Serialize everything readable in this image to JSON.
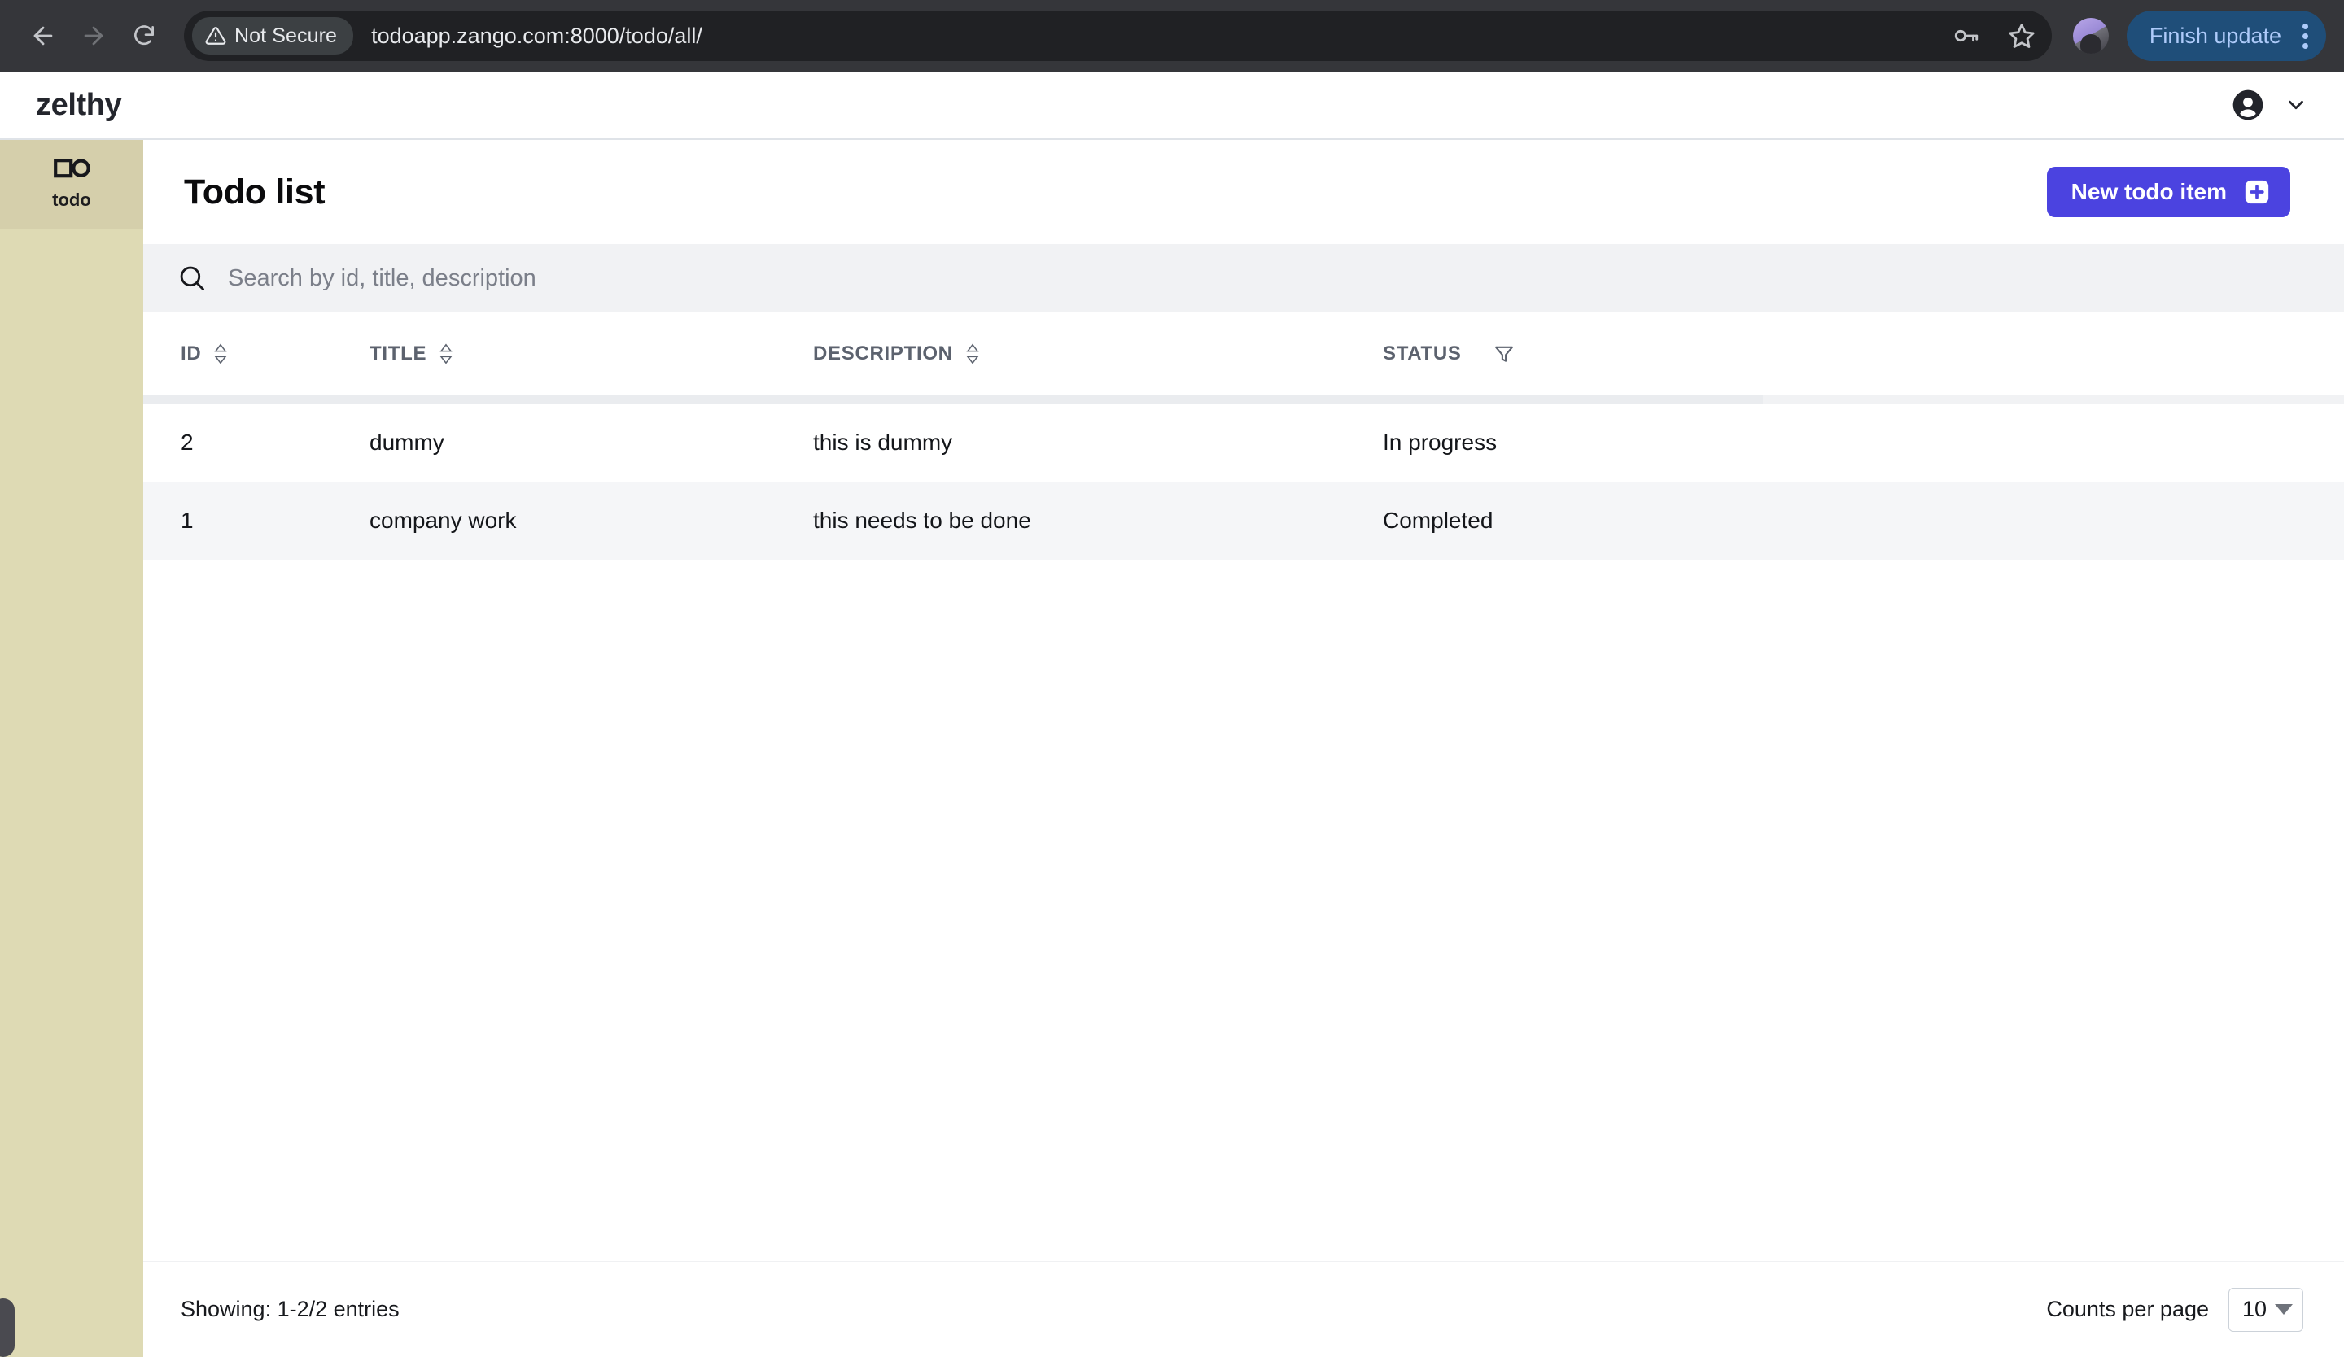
{
  "browser": {
    "back_icon": "back-arrow-icon",
    "forward_icon": "forward-arrow-icon",
    "reload_icon": "reload-icon",
    "security_label": "Not Secure",
    "url": "todoapp.zango.com:8000/todo/all/",
    "password_icon": "key-icon",
    "bookmark_icon": "star-icon",
    "profile_icon": "profile-avatar",
    "update_button": "Finish update",
    "menu_icon": "kebab-menu-icon"
  },
  "app_header": {
    "logo": "zelthy",
    "account_icon": "account-circle-icon",
    "account_caret_icon": "chevron-down-icon"
  },
  "sidebar": {
    "items": [
      {
        "label": "todo",
        "icon": "square-circle-icon",
        "active": true
      }
    ]
  },
  "page": {
    "title": "Todo list",
    "new_button_label": "New todo item",
    "new_button_icon": "add-square-icon",
    "accent_color": "#4b43e0"
  },
  "search": {
    "icon": "search-icon",
    "placeholder": "Search by id, title, description",
    "value": ""
  },
  "table": {
    "columns": [
      {
        "key": "id",
        "label": "ID",
        "sortable": true,
        "sort_icon": "sort-updown-icon"
      },
      {
        "key": "title",
        "label": "TITLE",
        "sortable": true,
        "sort_icon": "sort-updown-icon"
      },
      {
        "key": "description",
        "label": "DESCRIPTION",
        "sortable": true,
        "sort_icon": "sort-updown-icon"
      },
      {
        "key": "status",
        "label": "STATUS",
        "sortable": false,
        "filter_icon": "filter-funnel-icon"
      }
    ],
    "rows": [
      {
        "id": "2",
        "title": "dummy",
        "description": "this is dummy",
        "status": "In progress"
      },
      {
        "id": "1",
        "title": "company work",
        "description": "this needs to be done",
        "status": "Completed"
      }
    ]
  },
  "footer": {
    "showing": "Showing: 1-2/2 entries",
    "counts_label": "Counts per page",
    "counts_value": "10",
    "counts_caret_icon": "chevron-down-icon"
  }
}
